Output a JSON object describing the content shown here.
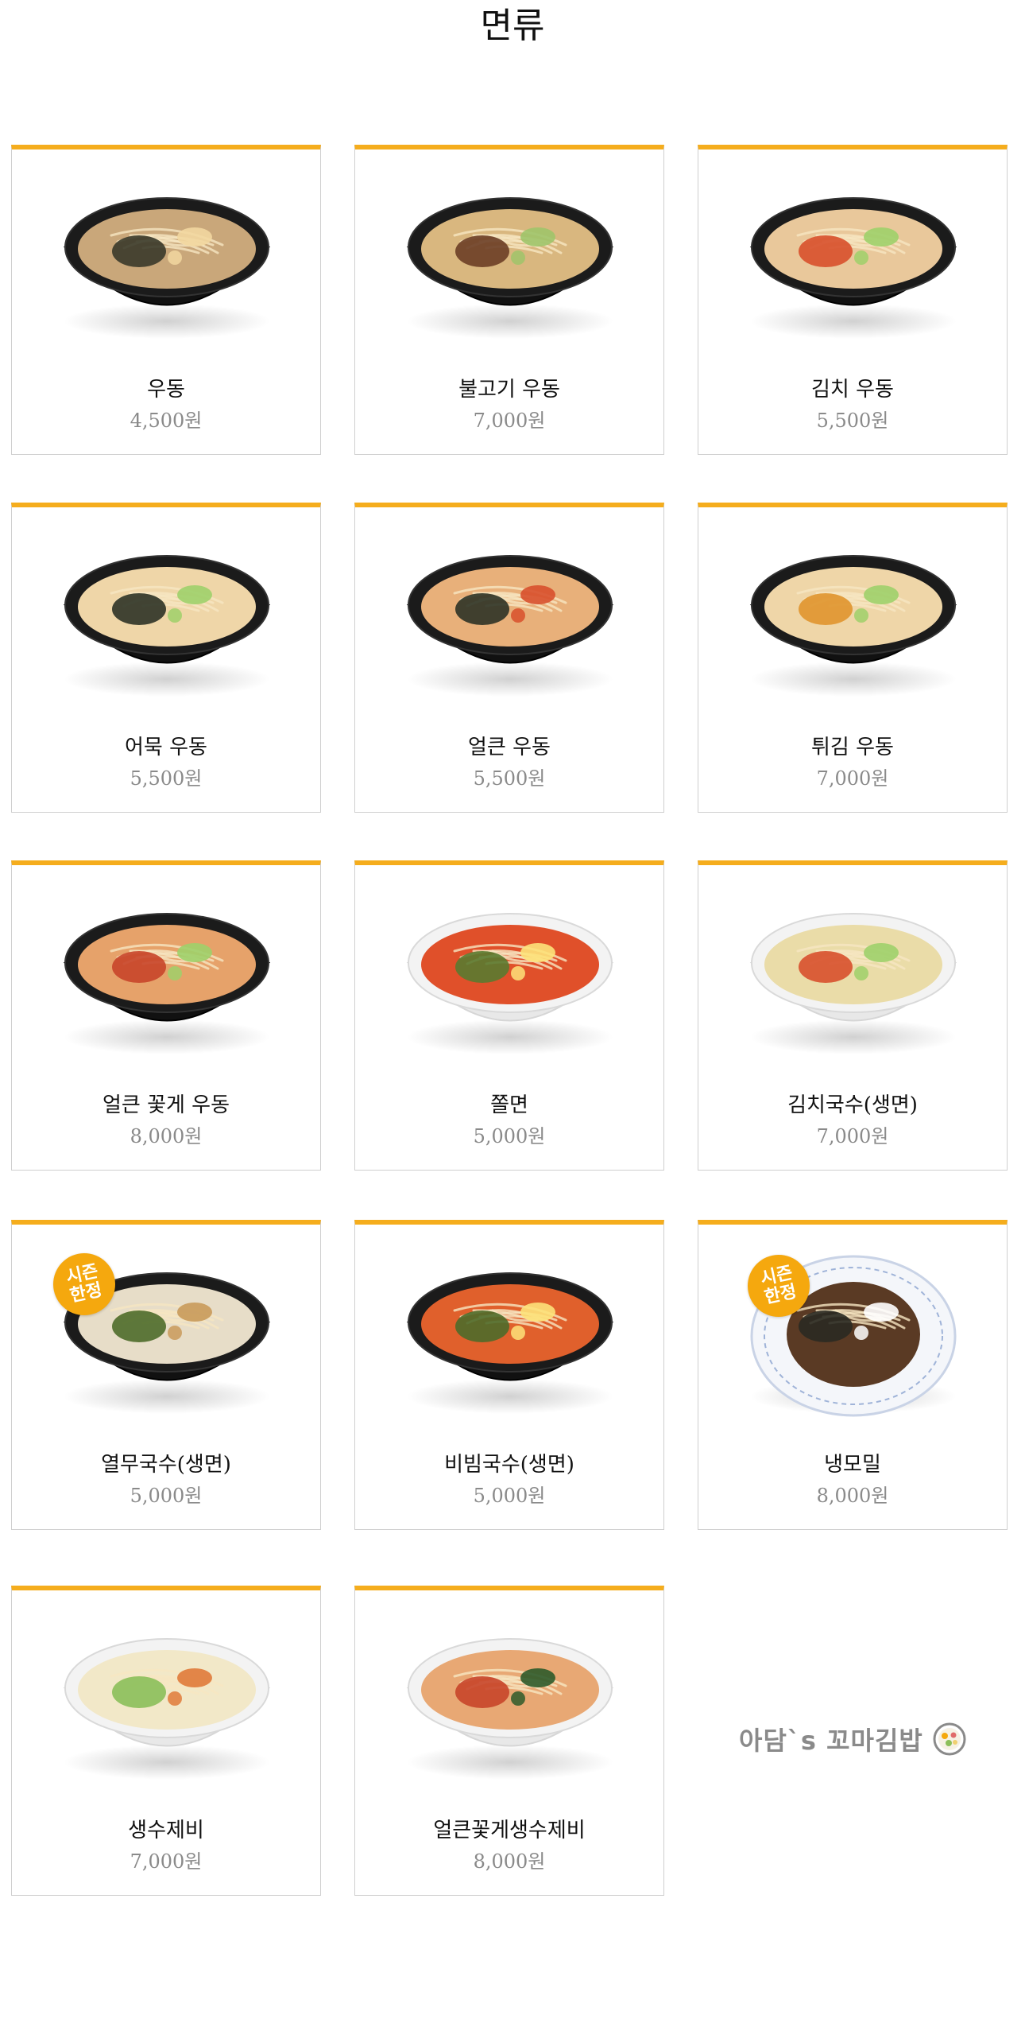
{
  "page": {
    "title": "면류"
  },
  "menu_items": [
    {
      "name": "우동",
      "price": "4,500원",
      "bowl": "black",
      "soup": "#c9a77a",
      "topping": "#3a3a2a",
      "accent": "#f2d7a0"
    },
    {
      "name": "불고기 우동",
      "price": "7,000원",
      "bowl": "black",
      "soup": "#d9b77f",
      "topping": "#6b3e26",
      "accent": "#9fc46a"
    },
    {
      "name": "김치 우동",
      "price": "5,500원",
      "bowl": "black",
      "soup": "#e9c89b",
      "topping": "#d8502c",
      "accent": "#9fd06a"
    },
    {
      "name": "어묵 우동",
      "price": "5,500원",
      "bowl": "black",
      "soup": "#efd6a8",
      "topping": "#2e3326",
      "accent": "#9fd06a"
    },
    {
      "name": "얼큰 우동",
      "price": "5,500원",
      "bowl": "black",
      "soup": "#e8b07a",
      "topping": "#2e3326",
      "accent": "#d8502c"
    },
    {
      "name": "튀김 우동",
      "price": "7,000원",
      "bowl": "black",
      "soup": "#efd6a8",
      "topping": "#e0952e",
      "accent": "#9fd06a"
    },
    {
      "name": "얼큰 꽃게 우동",
      "price": "8,000원",
      "bowl": "black",
      "soup": "#e6a26a",
      "topping": "#c8452a",
      "accent": "#9fd06a"
    },
    {
      "name": "쫄면",
      "price": "5,000원",
      "bowl": "white",
      "soup": "#e0502a",
      "topping": "#5a7a30",
      "accent": "#fde27a"
    },
    {
      "name": "김치국수(생면)",
      "price": "7,000원",
      "bowl": "white",
      "soup": "#eadca8",
      "topping": "#d8502c",
      "accent": "#9fd06a"
    },
    {
      "name": "열무국수(생면)",
      "price": "5,000원",
      "bowl": "black",
      "soup": "#e7ddc8",
      "topping": "#4e6b2a",
      "accent": "#c99a5a",
      "badge": {
        "line1": "시즌",
        "line2": "한정"
      }
    },
    {
      "name": "비빔국수(생면)",
      "price": "5,000원",
      "bowl": "black",
      "soup": "#e0602c",
      "topping": "#4e6b2a",
      "accent": "#fde27a"
    },
    {
      "name": "냉모밀",
      "price": "8,000원",
      "bowl": "plate",
      "soup": "#5a3a24",
      "topping": "#2a2a22",
      "accent": "#ffffff",
      "badge": {
        "line1": "시즌",
        "line2": "한정"
      }
    },
    {
      "name": "생수제비",
      "price": "7,000원",
      "bowl": "white",
      "soup": "#f2e8c8",
      "topping": "#8bbf5a",
      "accent": "#e07a3a"
    },
    {
      "name": "얼큰꽃게생수제비",
      "price": "8,000원",
      "bowl": "white",
      "soup": "#e8a874",
      "topping": "#c8452a",
      "accent": "#2e5a2a"
    }
  ],
  "brand": {
    "text": "아담`s 꼬마김밥",
    "logo_icon": "kimbap-roll-icon"
  },
  "colors": {
    "card_top_border": "#f5ad1d",
    "price_text": "#8a8a8a",
    "badge": "#f5a80e"
  }
}
